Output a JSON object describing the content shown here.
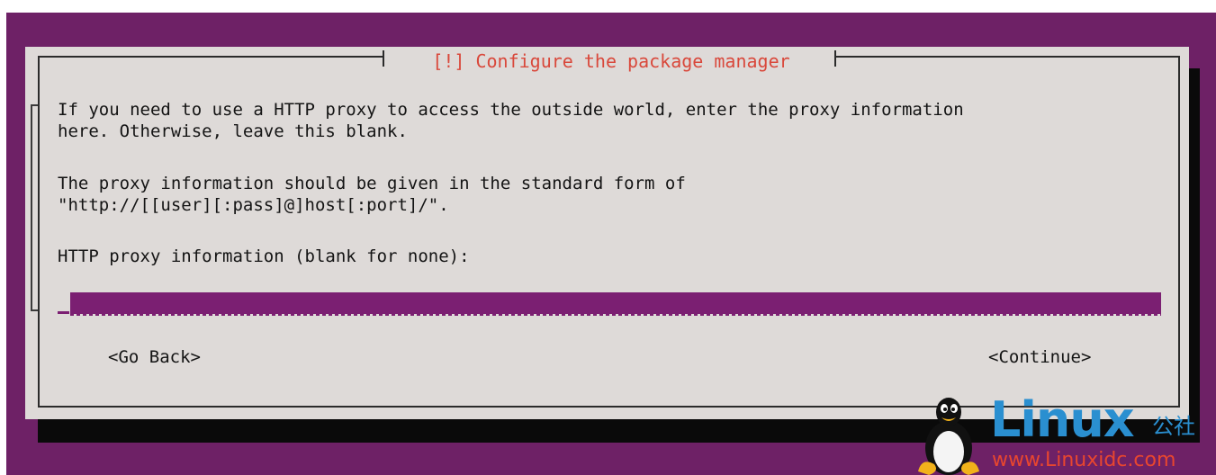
{
  "dialog": {
    "title": "[!] Configure the package manager",
    "paragraphs": [
      "If you need to use a HTTP proxy to access the outside world, enter the proxy information",
      "here. Otherwise, leave this blank.",
      "The proxy information should be given in the standard form of",
      "\"http://[[user][:pass]@]host[:port]/\"."
    ],
    "prompt": "HTTP proxy information (blank for none):",
    "input": {
      "value": "",
      "placeholder": ""
    },
    "buttons": {
      "back": "<Go Back>",
      "continue": "<Continue>"
    }
  },
  "watermark": {
    "name": "Linux",
    "suffix": "公社",
    "url": "www.Linuxidc.com",
    "icon": "penguin-icon"
  },
  "colors": {
    "background": "#6e2166",
    "dialog": "#dedad8",
    "title": "#d9483b",
    "input": "#7b1f72",
    "watermark_blue": "#2a8fd0",
    "watermark_red": "#e8462f"
  }
}
